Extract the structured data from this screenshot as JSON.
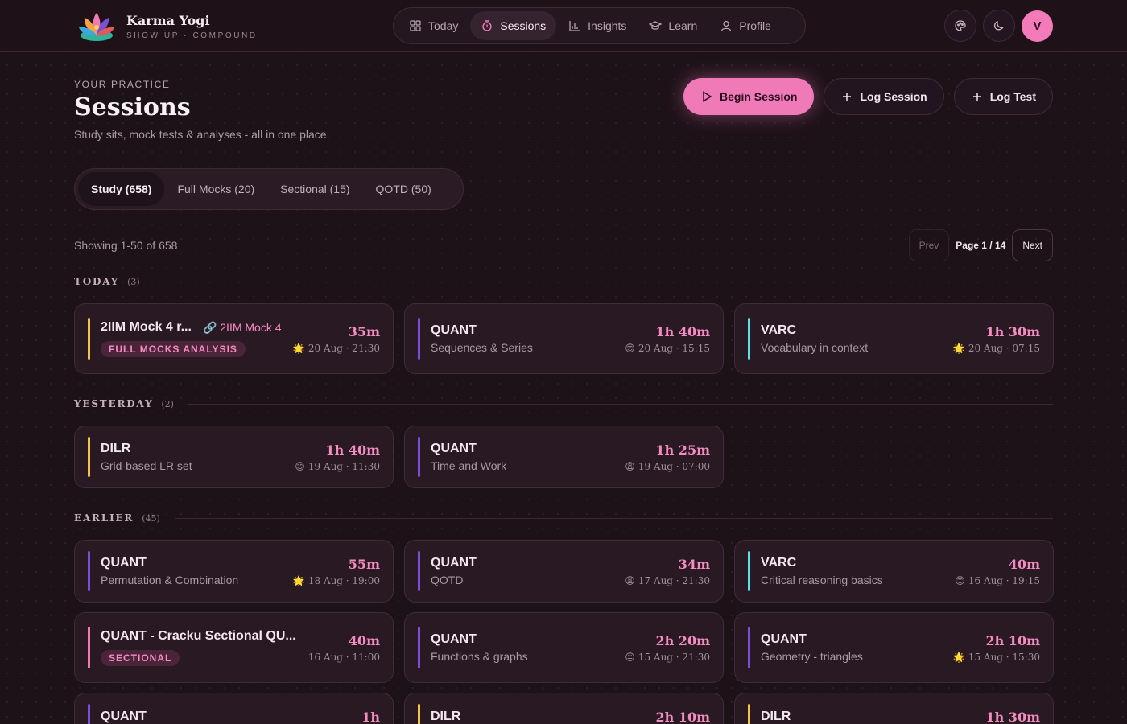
{
  "brand": {
    "name": "Karma Yogi",
    "tagline": "SHOW UP · COMPOUND"
  },
  "nav": [
    {
      "label": "Today",
      "icon": "grid-icon",
      "active": false
    },
    {
      "label": "Sessions",
      "icon": "timer-icon",
      "active": true
    },
    {
      "label": "Insights",
      "icon": "bar-chart-icon",
      "active": false
    },
    {
      "label": "Learn",
      "icon": "graduation-cap-icon",
      "active": false
    },
    {
      "label": "Profile",
      "icon": "user-icon",
      "active": false
    }
  ],
  "header": {
    "avatar_initial": "V",
    "palette_icon": "palette-icon",
    "theme_icon": "moon-icon"
  },
  "page": {
    "eyebrow": "YOUR PRACTICE",
    "title": "Sessions",
    "subtitle": "Study sits, mock tests & analyses - all in one place."
  },
  "actions": {
    "begin": "Begin Session",
    "log_session": "Log Session",
    "log_test": "Log Test"
  },
  "tabs": [
    {
      "label": "Study (658)",
      "active": true
    },
    {
      "label": "Full Mocks (20)",
      "active": false
    },
    {
      "label": "Sectional (15)",
      "active": false
    },
    {
      "label": "QOTD (50)",
      "active": false
    }
  ],
  "listing": {
    "showing": "Showing 1-50 of 658",
    "prev": "Prev",
    "page": "Page 1 / 14",
    "next": "Next"
  },
  "colors": {
    "quant": "#7a4fd6",
    "varc": "#5ee0ef",
    "dilr": "#f4c24d",
    "mock": "#f4c24d",
    "sectional": "#f07ab8",
    "accent": "#f07ab8"
  },
  "sections": [
    {
      "title": "TODAY",
      "count": "(3)",
      "cards": [
        {
          "title": "2IIM Mock 4 r...",
          "link": "2IIM Mock 4",
          "badge": "FULL MOCKS ANALYSIS",
          "sub": "",
          "duration": "35m",
          "emoji": "🌟",
          "meta": "20 Aug · 21:30",
          "color": "mock"
        },
        {
          "title": "QUANT",
          "sub": "Sequences & Series",
          "duration": "1h 40m",
          "emoji": "😊",
          "meta": "20 Aug · 15:15",
          "color": "quant"
        },
        {
          "title": "VARC",
          "sub": "Vocabulary in context",
          "duration": "1h 30m",
          "emoji": "🌟",
          "meta": "20 Aug · 07:15",
          "color": "varc"
        }
      ]
    },
    {
      "title": "YESTERDAY",
      "count": "(2)",
      "cards": [
        {
          "title": "DILR",
          "sub": "Grid-based LR set",
          "duration": "1h 40m",
          "emoji": "😊",
          "meta": "19 Aug · 11:30",
          "color": "dilr"
        },
        {
          "title": "QUANT",
          "sub": "Time and Work",
          "duration": "1h 25m",
          "emoji": "😩",
          "meta": "19 Aug · 07:00",
          "color": "quant"
        }
      ]
    },
    {
      "title": "EARLIER",
      "count": "(45)",
      "cards": [
        {
          "title": "QUANT",
          "sub": "Permutation & Combination",
          "duration": "55m",
          "emoji": "🌟",
          "meta": "18 Aug · 19:00",
          "color": "quant"
        },
        {
          "title": "QUANT",
          "sub": "QOTD",
          "duration": "34m",
          "emoji": "😩",
          "meta": "17 Aug · 21:30",
          "color": "quant"
        },
        {
          "title": "VARC",
          "sub": "Critical reasoning basics",
          "duration": "40m",
          "emoji": "😊",
          "meta": "16 Aug · 19:15",
          "color": "varc"
        },
        {
          "title": "QUANT - Cracku Sectional QU...",
          "badge": "SECTIONAL",
          "sub": "",
          "duration": "40m",
          "emoji": "",
          "meta": "16 Aug · 11:00",
          "color": "sectional"
        },
        {
          "title": "QUANT",
          "sub": "Functions & graphs",
          "duration": "2h 20m",
          "emoji": "😐",
          "meta": "15 Aug · 21:30",
          "color": "quant"
        },
        {
          "title": "QUANT",
          "sub": "Geometry - triangles",
          "duration": "2h 10m",
          "emoji": "🌟",
          "meta": "15 Aug · 15:30",
          "color": "quant"
        },
        {
          "title": "QUANT",
          "sub": "",
          "duration": "1h",
          "emoji": "",
          "meta": "",
          "color": "quant"
        },
        {
          "title": "DILR",
          "sub": "",
          "duration": "2h 10m",
          "emoji": "",
          "meta": "",
          "color": "dilr"
        },
        {
          "title": "DILR",
          "sub": "",
          "duration": "1h 30m",
          "emoji": "",
          "meta": "",
          "color": "dilr"
        }
      ]
    }
  ]
}
